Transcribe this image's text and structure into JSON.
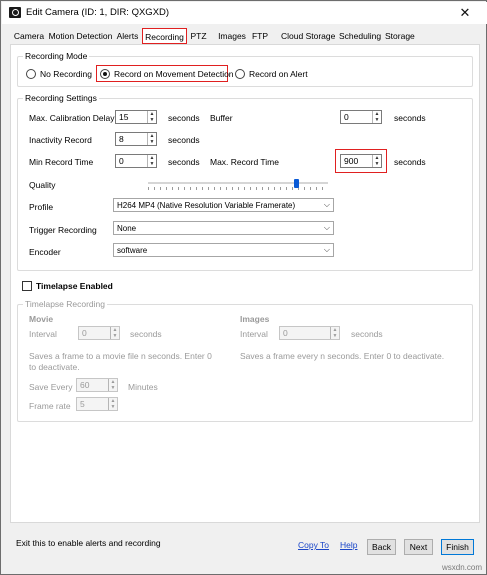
{
  "window": {
    "title": "Edit Camera (ID: 1, DIR: QXGXD)",
    "close_glyph": "✕"
  },
  "tabs": [
    {
      "label": "Camera"
    },
    {
      "label": "Motion Detection"
    },
    {
      "label": "Alerts"
    },
    {
      "label": "Recording"
    },
    {
      "label": "PTZ"
    },
    {
      "label": "Images"
    },
    {
      "label": "FTP"
    },
    {
      "label": "Cloud Storage"
    },
    {
      "label": "Scheduling"
    },
    {
      "label": "Storage"
    }
  ],
  "active_tab": "Recording",
  "recording_mode": {
    "title": "Recording Mode",
    "options": [
      "No Recording",
      "Record on Movement Detection",
      "Record on Alert"
    ],
    "selected": "Record on Movement Detection"
  },
  "recording_settings": {
    "title": "Recording Settings",
    "max_calibration_delay": {
      "label": "Max. Calibration Delay",
      "value": "15",
      "unit": "seconds"
    },
    "buffer": {
      "label": "Buffer",
      "value": "0",
      "unit": "seconds"
    },
    "inactivity_record": {
      "label": "Inactivity Record",
      "value": "8",
      "unit": "seconds"
    },
    "min_record_time": {
      "label": "Min Record Time",
      "value": "0",
      "unit": "seconds"
    },
    "max_record_time": {
      "label": "Max. Record Time",
      "value": "900",
      "unit": "seconds"
    },
    "quality": {
      "label": "Quality",
      "level": 0.82
    },
    "profile": {
      "label": "Profile",
      "value": "H264 MP4 (Native Resolution Variable Framerate)"
    },
    "trigger_recording": {
      "label": "Trigger Recording",
      "value": "None"
    },
    "encoder": {
      "label": "Encoder",
      "value": "software"
    }
  },
  "timelapse": {
    "enabled_label": "Timelapse Enabled",
    "group_title": "Timelapse Recording",
    "movie": {
      "heading": "Movie",
      "interval": {
        "label": "Interval",
        "value": "0",
        "unit": "seconds"
      },
      "note": "Saves a frame to a movie file n seconds. Enter 0 to deactivate.",
      "save_every": {
        "label": "Save Every",
        "value": "60",
        "unit": "Minutes"
      },
      "frame_rate": {
        "label": "Frame rate",
        "value": "5"
      }
    },
    "images": {
      "heading": "Images",
      "interval": {
        "label": "Interval",
        "value": "0",
        "unit": "seconds"
      },
      "note": "Saves a frame every n seconds. Enter 0 to deactivate."
    }
  },
  "footer": {
    "hint": "Exit this to enable alerts and recording",
    "copy_to": "Copy To",
    "help": "Help",
    "back": "Back",
    "next": "Next",
    "finish": "Finish",
    "watermark": "wsxdn.com"
  },
  "colors": {
    "highlight": "#e02020",
    "link": "#1a46c8",
    "slider_thumb": "#0a5bd6"
  }
}
